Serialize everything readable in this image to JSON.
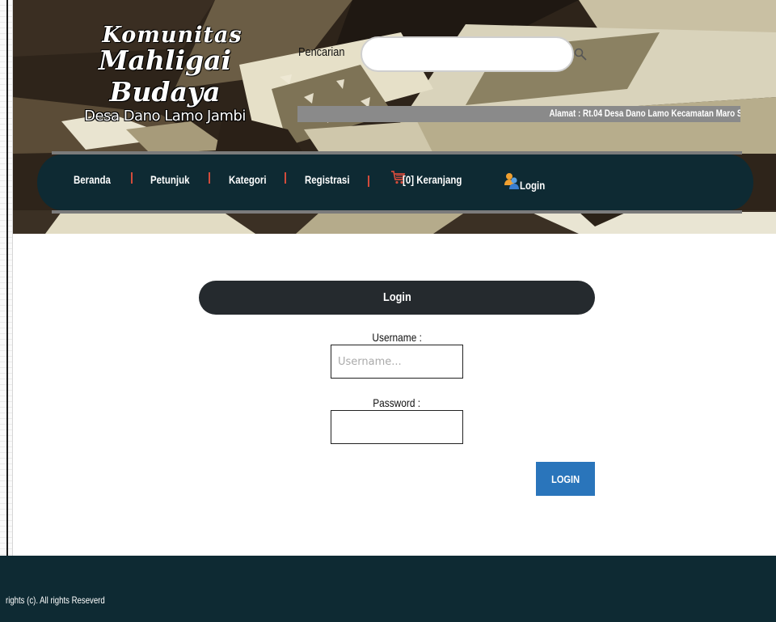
{
  "header": {
    "logo": {
      "line1": "Komunitas",
      "line2": "Mahligai Budaya",
      "line3": "Desa Dano Lamo Jambi"
    },
    "search": {
      "label": "Pencarian",
      "value": "",
      "placeholder": ""
    },
    "marquee": "Alamat : Rt.04 Desa Dano Lamo Kecamatan Maro S"
  },
  "nav": {
    "items": [
      {
        "label": "Beranda"
      },
      {
        "label": "Petunjuk"
      },
      {
        "label": "Kategori"
      },
      {
        "label": "Registrasi"
      }
    ],
    "separator": "|",
    "cart_label": "[0] Keranjang",
    "login_label": "Login",
    "icons": {
      "cart": "cart-icon",
      "login": "users-icon"
    }
  },
  "login": {
    "title": "Login",
    "username_label": "Username :",
    "username_placeholder": "Username...",
    "password_label": "Password :",
    "submit_label": "LOGIN"
  },
  "footer": {
    "text": "rights (c). All rights Reseverd"
  },
  "colors": {
    "nav_bg": "#0e2a33",
    "login_header_bg": "#252a2e",
    "button_bg": "#2a75bb",
    "separator": "#d24b3b"
  }
}
